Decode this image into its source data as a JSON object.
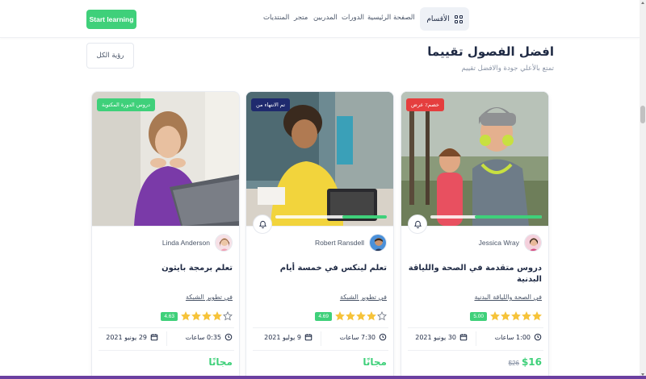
{
  "header": {
    "start_button": "Start learning",
    "nav": [
      "الصفحة الرئيسية",
      "الدورات",
      "المدربين",
      "متجر",
      "المنتديات"
    ],
    "categories_label": "الأقسام"
  },
  "section": {
    "title": "افضل الفصول تقييما",
    "subtitle": "تمتع بالأعلي جودة والافضل تقييم",
    "view_all": "رؤية الكل"
  },
  "colors": {
    "accent": "#3fd07a",
    "badge_red": "#e53e3e",
    "badge_navy": "#1f2a6e",
    "badge_green": "#3fd07a",
    "star": "#f6c33a"
  },
  "cards": [
    {
      "badge": "خصم٪ عرض",
      "badge_color": "#e53e3e",
      "progress": 0.6,
      "instructor": "Jessica Wray",
      "title": "دروس متقدمة في الصحة واللياقة البدنية",
      "category": "في الصحة واللياقة البدنية",
      "rating": "5.00",
      "stars": 5,
      "duration": "1:00 ساعات",
      "date": "30 يونيو 2021",
      "price": "$16",
      "old_price": "$26"
    },
    {
      "badge": "تم الانتهاء من",
      "badge_color": "#1f2a6e",
      "progress": 0.4,
      "instructor": "Robert Ransdell",
      "title": "تعلم لينكس في خمسة أيام",
      "category": "في تطوير الشبكة",
      "rating": "4.69",
      "stars": 4,
      "duration": "7:30 ساعات",
      "date": "9 يوليو 2021",
      "price": "مجانًا",
      "old_price": ""
    },
    {
      "badge": "دروس الدورة المكتوبة",
      "badge_color": "#3fd07a",
      "progress": 0,
      "instructor": "Linda Anderson",
      "title": "تعلم برمجة بايثون",
      "category": "في تطوير الشبكة",
      "rating": "4.63",
      "stars": 4,
      "duration": "0:35 ساعات",
      "date": "29 يونيو 2021",
      "price": "مجانًا",
      "old_price": ""
    }
  ]
}
